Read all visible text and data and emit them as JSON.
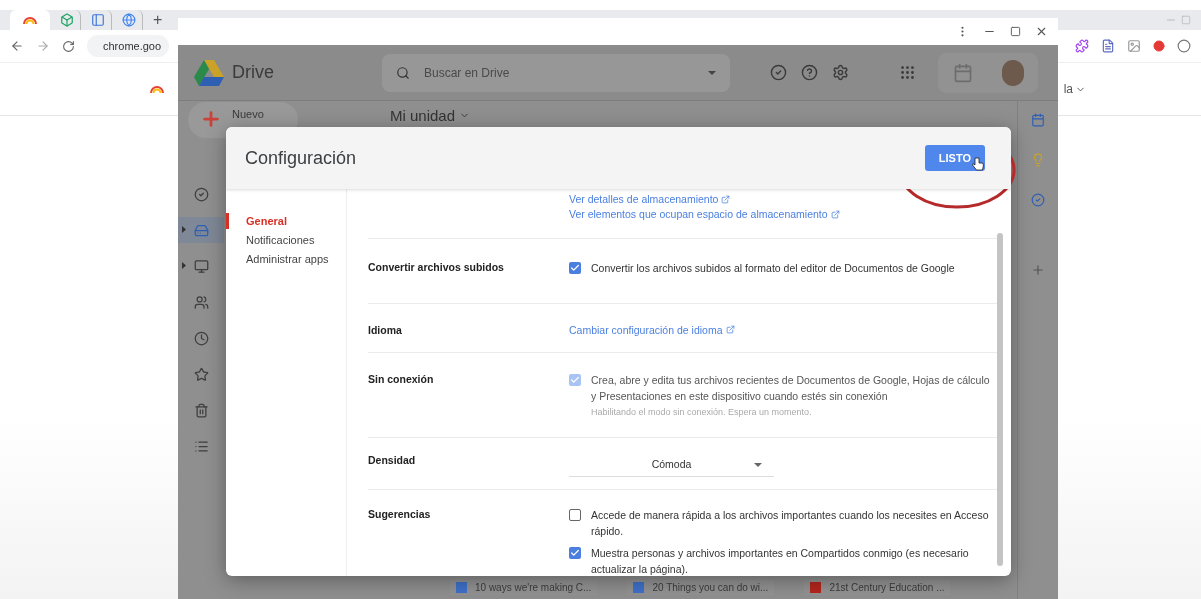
{
  "browser": {
    "tabs": [
      {
        "kind": "rainbow",
        "selected": true
      },
      {
        "kind": "cube",
        "selected": false
      },
      {
        "kind": "panel",
        "selected": false
      },
      {
        "kind": "globe",
        "selected": false
      }
    ],
    "new_tab": "+",
    "address": "chrome.goo",
    "profile_menu": "la"
  },
  "drive": {
    "app_name": "Drive",
    "search": {
      "placeholder": "Buscar en Drive"
    },
    "new_button": "Nuevo",
    "location": "Mi unidad",
    "rail": [
      {
        "kind": "priority",
        "selected": false,
        "expandable": false
      },
      {
        "kind": "my-drive",
        "selected": true,
        "expandable": true
      },
      {
        "kind": "shared-drives",
        "selected": false,
        "expandable": true
      },
      {
        "kind": "shared",
        "selected": false,
        "expandable": false
      },
      {
        "kind": "recent",
        "selected": false,
        "expandable": false
      },
      {
        "kind": "starred",
        "selected": false,
        "expandable": false
      },
      {
        "kind": "trash",
        "selected": false,
        "expandable": false
      },
      {
        "kind": "storage",
        "selected": false,
        "expandable": false
      }
    ],
    "files": [
      {
        "kind": "doc",
        "name": "10 ways we're making C..."
      },
      {
        "kind": "doc",
        "name": "20 Things you can do wi..."
      },
      {
        "kind": "slides",
        "name": "21st Century Education ..."
      }
    ]
  },
  "dialog": {
    "title": "Configuración",
    "done_button": "LISTO",
    "nav": [
      {
        "label": "General",
        "selected": true
      },
      {
        "label": "Notificaciones",
        "selected": false
      },
      {
        "label": "Administrar apps",
        "selected": false
      }
    ],
    "rows": [
      {
        "kind": "links",
        "links": [
          "Ver detalles de almacenamiento",
          "Ver elementos que ocupan espacio de almacenamiento"
        ]
      },
      {
        "kind": "checkboxes",
        "label": "Convertir archivos subidos",
        "options": [
          {
            "text": "Convertir los archivos subidos al formato del editor de Documentos de Google",
            "checked": true,
            "disabled": false
          }
        ]
      },
      {
        "kind": "links",
        "label": "Idioma",
        "links": [
          "Cambiar configuración de idioma"
        ]
      },
      {
        "kind": "checkboxes",
        "label": "Sin conexión",
        "options": [
          {
            "text": "Crea, abre y edita tus archivos recientes de Documentos de Google, Hojas de cálculo y Presentaciones en este dispositivo cuando estés sin conexión",
            "checked": true,
            "disabled": true,
            "note": "Habilitando el modo sin conexión. Espera un momento."
          }
        ]
      },
      {
        "kind": "select",
        "label": "Densidad",
        "value": "Cómoda"
      },
      {
        "kind": "checkboxes",
        "label": "Sugerencias",
        "options": [
          {
            "text": "Accede de manera rápida a los archivos importantes cuando los necesites en Acceso rápido.",
            "checked": false,
            "disabled": false
          },
          {
            "text": "Muestra personas y archivos importantes en Compartidos conmigo (es necesario actualizar la página).",
            "checked": true,
            "disabled": false
          }
        ]
      }
    ]
  }
}
